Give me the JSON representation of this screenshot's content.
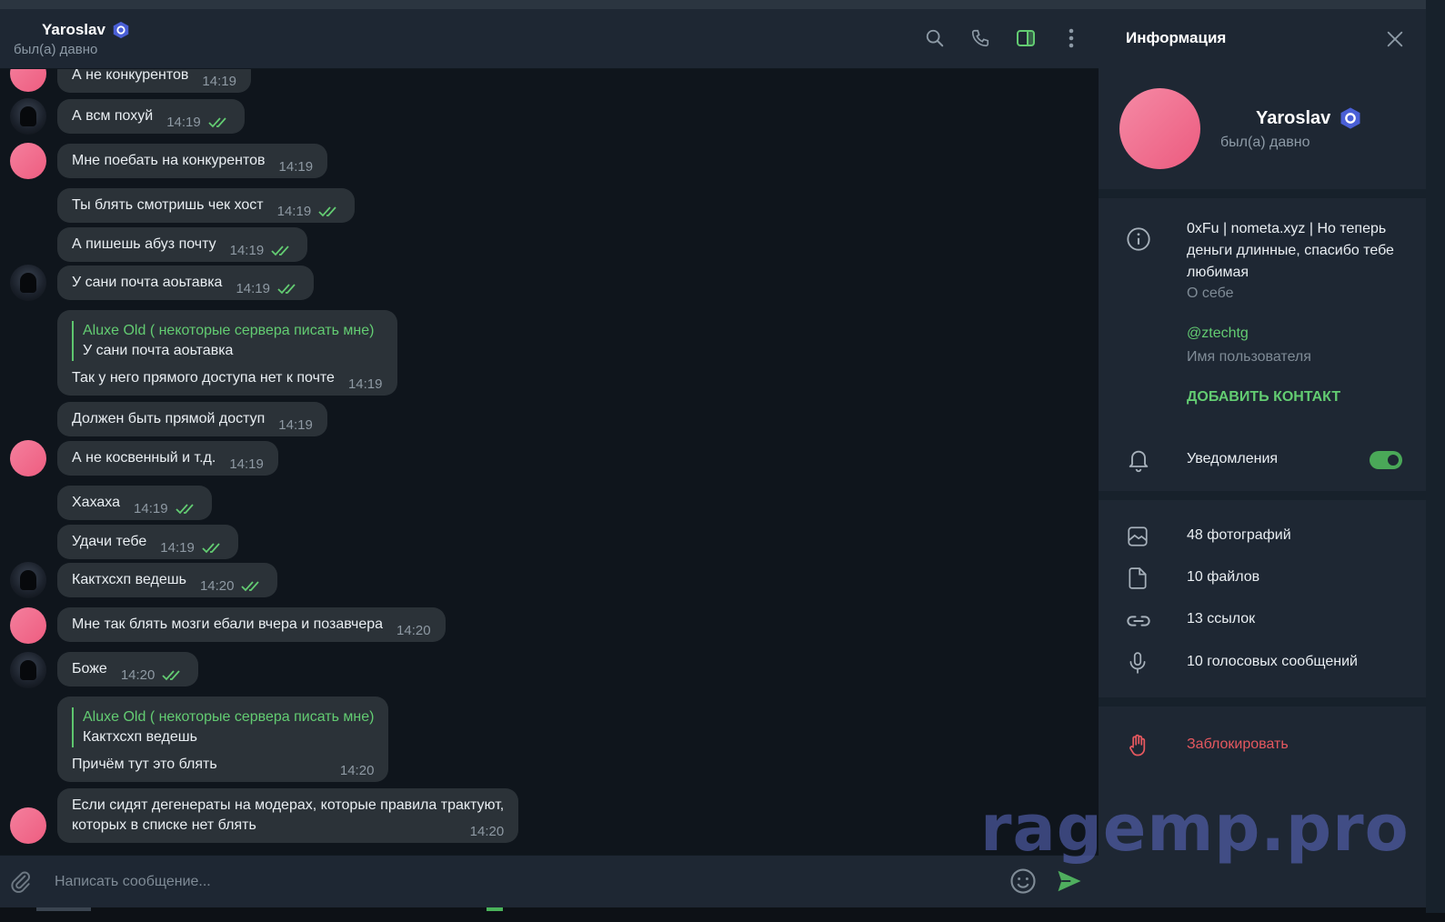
{
  "chat": {
    "title": "Yaroslav",
    "status": "был(а) давно"
  },
  "messages": [
    {
      "text": "А не конкурентов",
      "time": "14:19"
    },
    {
      "text": "А всм похуй",
      "time": "14:19",
      "read": true
    },
    {
      "text": "Мне поебать на конкурентов",
      "time": "14:19"
    },
    {
      "text": "Ты блять смотришь чек хост",
      "time": "14:19",
      "read": true
    },
    {
      "text": "А пишешь абуз почту",
      "time": "14:19",
      "read": true
    },
    {
      "text": "У сани почта аоьтавка",
      "time": "14:19",
      "read": true
    },
    {
      "reply_author": "Aluxe Old ( некоторые сервера писать мне)",
      "reply_text": "У сани почта аоьтавка",
      "text": "Так у него прямого доступа нет к почте",
      "time": "14:19"
    },
    {
      "text": "Должен быть прямой доступ",
      "time": "14:19"
    },
    {
      "text": "А не косвенный и т.д.",
      "time": "14:19"
    },
    {
      "text": "Хахаха",
      "time": "14:19",
      "read": true
    },
    {
      "text": "Удачи тебе",
      "time": "14:19",
      "read": true
    },
    {
      "text": "Кактхсхп ведешь",
      "time": "14:20",
      "read": true
    },
    {
      "text": "Мне так блять мозги ебали вчера и позавчера",
      "time": "14:20"
    },
    {
      "text": "Боже",
      "time": "14:20",
      "read": true
    },
    {
      "reply_author": "Aluxe Old ( некоторые сервера писать мне)",
      "reply_text": "Кактхсхп ведешь",
      "text": "Причём тут это блять",
      "time": "14:20"
    },
    {
      "text_line1": "Если сидят дегенераты на модерах, которые правила трактуют,",
      "text_line2": "которых в списке нет блять",
      "time": "14:20"
    }
  ],
  "composer": {
    "placeholder": "Написать сообщение..."
  },
  "info": {
    "title": "Информация",
    "name": "Yaroslav",
    "status": "был(а) давно",
    "bio": "0xFu | nometa.xyz | Но теперь деньги длинные, спасибо тебе любимая",
    "bio_label": "О себе",
    "username": "@ztechtg",
    "username_label": "Имя пользователя",
    "add_contact": "ДОБАВИТЬ КОНТАКТ",
    "notifications": "Уведомления",
    "notifications_on": true,
    "photos": "48 фотографий",
    "files": "10 файлов",
    "links": "13 ссылок",
    "voice": "10 голосовых сообщений",
    "block": "Заблокировать"
  },
  "watermark": "ragemp.pro",
  "colors": {
    "accent_green": "#63cc72",
    "danger_red": "#e5585f",
    "bubble": "#2b3238",
    "panel": "#1e2733",
    "chat_bg": "#0f151c"
  }
}
